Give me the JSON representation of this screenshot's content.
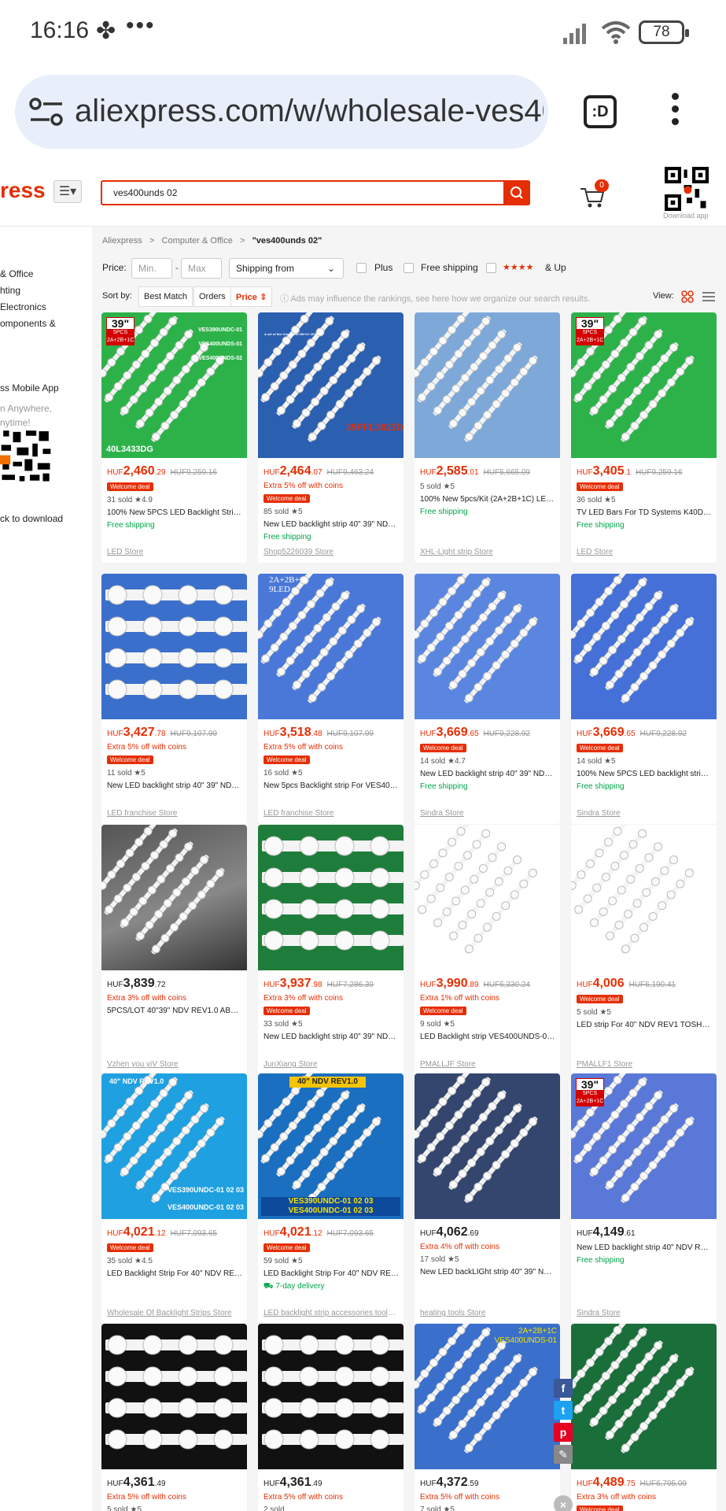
{
  "status_bar": {
    "time": "16:16",
    "fan_glyph": "✤",
    "dots": "•••",
    "battery": "78"
  },
  "browser": {
    "url": "aliexpress.com/w/wholesale-ves40",
    "tabs_label": ":D"
  },
  "header": {
    "logo": "ress",
    "search_value": "ves400unds 02",
    "cart_count": "0",
    "download_app": "Download app"
  },
  "sidebar": {
    "categories": [
      "& Office",
      "hting",
      "Electronics",
      "omponents &"
    ],
    "app_title": "ss Mobile App",
    "app_sub": "n Anywhere,\nnytime!",
    "app_download": "ck to download"
  },
  "breadcrumb": {
    "items": [
      "Aliexpress",
      "Computer & Office"
    ],
    "current": "\"ves400unds 02\"",
    "sep": ">"
  },
  "filters": {
    "price_label": "Price:",
    "min_placeholder": "Min.",
    "dash": "-",
    "max_placeholder": "Max",
    "shipping_from": "Shipping from",
    "plus": "Plus",
    "free_shipping": "Free shipping",
    "stars": "★★★★",
    "and_up": "& Up"
  },
  "sort": {
    "label": "Sort by:",
    "options": [
      "Best Match",
      "Orders",
      "Price ⇕"
    ],
    "notice": "ⓘ Ads may influence the rankings, see here how we organize our search results.",
    "view_label": "View:"
  },
  "products": [
    {
      "price_prefix": "HUF",
      "price": "2,460",
      "cents": ".29",
      "old": "HUF9,259.16",
      "coins": "",
      "welcome": "Welcome deal",
      "meta": "31 sold  ★4.9",
      "title": "100% New 5PCS LED Backlight Strip for 39\" TV",
      "ship": "Free shipping",
      "store": "LED Store"
    },
    {
      "price_prefix": "HUF",
      "price": "2,464",
      "cents": ".07",
      "old": "HUF9,463.24",
      "coins": "Extra 5% off with coins",
      "welcome": "Welcome deal",
      "meta": "85 sold  ★5",
      "title": "New LED backlight strip 40\" 39\" NDV REV1.0",
      "ship": "Free shipping",
      "store": "Shop5226039 Store"
    },
    {
      "price_prefix": "HUF",
      "price": "2,585",
      "cents": ".01",
      "old": "HUF5,665.09",
      "coins": "",
      "welcome": "",
      "meta": "5 sold  ★5",
      "title": "100% New 5pcs/Kit (2A+2B+1C) LED Backlight",
      "ship": "Free shipping",
      "store": "XHL-Light strip Store"
    },
    {
      "price_prefix": "HUF",
      "price": "3,405",
      "cents": ".1",
      "old": "HUF9,259.16",
      "coins": "",
      "welcome": "Welcome deal",
      "meta": "36 sold  ★5",
      "title": "TV LED Bars For TD Systems K40DLM",
      "ship": "Free shipping",
      "store": "LED Store"
    },
    {
      "price_prefix": "HUF",
      "price": "3,427",
      "cents": ".78",
      "old": "HUF9,107.99",
      "coins": "Extra 5% off with coins",
      "welcome": "Welcome deal",
      "meta": "11 sold  ★5",
      "title": "New LED backlight strip 40\" 39\" NDV REV1.0",
      "ship": "",
      "store": "LED franchise Store"
    },
    {
      "price_prefix": "HUF",
      "price": "3,518",
      "cents": ".48",
      "old": "HUF9,107.99",
      "coins": "Extra 5% off with coins",
      "welcome": "Welcome deal",
      "meta": "16 sold  ★5",
      "title": "New 5pcs Backlight strip For VES400UNDS",
      "ship": "",
      "store": "LED franchise Store"
    },
    {
      "price_prefix": "HUF",
      "price": "3,669",
      "cents": ".65",
      "old": "HUF9,228.92",
      "coins": "",
      "welcome": "Welcome deal",
      "meta": "14 sold  ★4.7",
      "title": "New LED backlight strip 40\" 39\" NDV REV1.0",
      "ship": "Free shipping",
      "store": "Sindra Store"
    },
    {
      "price_prefix": "HUF",
      "price": "3,669",
      "cents": ".65",
      "old": "HUF9,228.92",
      "coins": "",
      "welcome": "Welcome deal",
      "meta": "14 sold  ★5",
      "title": "100% New 5PCS LED backlight strip for 39\"",
      "ship": "Free shipping",
      "store": "Sindra Store"
    },
    {
      "price_prefix": "HUF",
      "price": "3,839",
      "cents": ".72",
      "old": "",
      "coins": "Extra 3% off with coins",
      "welcome": "",
      "meta": "",
      "title": "5PCS/LOT 40\"39\" NDV REV1.0 ABC Type",
      "ship": "",
      "store": "Vzhen you yiV Store"
    },
    {
      "price_prefix": "HUF",
      "price": "3,937",
      "cents": ".98",
      "old": "HUF7,286.39",
      "coins": "Extra 3% off with coins",
      "welcome": "Welcome deal",
      "meta": "33 sold  ★5",
      "title": "New LED backlight strip 40\" 39\" NDV REV1.0",
      "ship": "",
      "store": "JunXiang Store"
    },
    {
      "price_prefix": "HUF",
      "price": "3,990",
      "cents": ".89",
      "old": "HUF6,330.24",
      "coins": "Extra 1% off with coins",
      "welcome": "Welcome deal",
      "meta": "9 sold  ★5",
      "title": "LED Backlight strip VES400UNDS-01 02 03",
      "ship": "",
      "store": "PMALLJF Store"
    },
    {
      "price_prefix": "HUF",
      "price": "4,006",
      "cents": "",
      "old": "HUF6,190.41",
      "coins": "",
      "welcome": "Welcome deal",
      "meta": "5 sold  ★5",
      "title": "LED strip For 40\" NDV REV1 TOSHIBA",
      "ship": "",
      "store": "PMALLF1 Store"
    },
    {
      "price_prefix": "HUF",
      "price": "4,021",
      "cents": ".12",
      "old": "HUF7,093.65",
      "coins": "",
      "welcome": "Welcome deal",
      "meta": "35 sold  ★4.5",
      "title": "LED Backlight Strip For 40\" NDV REV1.0",
      "ship": "",
      "store": "Wholesale Of Backlight Strips Store"
    },
    {
      "price_prefix": "HUF",
      "price": "4,021",
      "cents": ".12",
      "old": "HUF7,093.65",
      "coins": "",
      "welcome": "Welcome deal",
      "meta": "59 sold  ★5",
      "title": "LED Backlight Strip For 40\" NDV REV1.0",
      "ship": "⛟ 7-day delivery",
      "store": "LED backlight strip accessories tools Store"
    },
    {
      "price_prefix": "HUF",
      "price": "4,062",
      "cents": ".69",
      "old": "",
      "coins": "Extra 4% off with coins",
      "welcome": "",
      "meta": "17 sold  ★5",
      "title": "New LED backLIGht strip 40\" 39\" NDV REV1.0",
      "ship": "",
      "store": "heating tools Store"
    },
    {
      "price_prefix": "HUF",
      "price": "4,149",
      "cents": ".61",
      "old": "",
      "coins": "",
      "welcome": "",
      "meta": "",
      "title": "New LED backlight strip 40\" NDV REV1.0",
      "ship": "Free shipping",
      "store": "Sindra Store"
    },
    {
      "price_prefix": "HUF",
      "price": "4,361",
      "cents": ".49",
      "old": "",
      "coins": "Extra 5% off with coins",
      "welcome": "",
      "meta": "5 sold  ★5",
      "title": "",
      "ship": "",
      "store": ""
    },
    {
      "price_prefix": "HUF",
      "price": "4,361",
      "cents": ".49",
      "old": "",
      "coins": "Extra 5% off with coins",
      "welcome": "",
      "meta": "2 sold",
      "title": "",
      "ship": "",
      "store": ""
    },
    {
      "price_prefix": "HUF",
      "price": "4,372",
      "cents": ".59",
      "old": "",
      "coins": "Extra 5% off with coins",
      "welcome": "",
      "meta": "7 sold  ★5",
      "title": "",
      "ship": "",
      "store": ""
    },
    {
      "price_prefix": "HUF",
      "price": "4,489",
      "cents": ".75",
      "old": "HUF6,795.09",
      "coins": "Extra 3% off with coins",
      "welcome": "Welcome deal",
      "meta": "",
      "title": "",
      "ship": "",
      "store": ""
    }
  ],
  "image_labels": {
    "p0_model": "VES390UNDC-01\nVES400UNDS-01\nVES400UNDS-02",
    "p0_bottom": "40L3433DG",
    "p1_bottom": "39PFL3025D",
    "p1_top": "A set of five 9-lamp 2A+2B+1C 397MM",
    "p5_top": "2A+2B+C\n9LED",
    "p12_top": "40\" NDV REV1.0",
    "p12_bottom": "VES390UNDC-01 02 03\nVES400UNDC-01 02 03",
    "p13_top": "40\" NDV REV1.0",
    "p13_bottom": "VES390UNDC-01  02  03\nVES400UNDC-01  02  03",
    "p18_top": "2A+2B+1C\nVES400UNDS-01",
    "tag39": "39\"",
    "tag5pcs": "5PCS",
    "tag_sub": "2A+2B+1C"
  },
  "colors": {
    "brand": "#e62e04",
    "free_shipping": "#00a54a",
    "welcome": "#e62e04"
  }
}
